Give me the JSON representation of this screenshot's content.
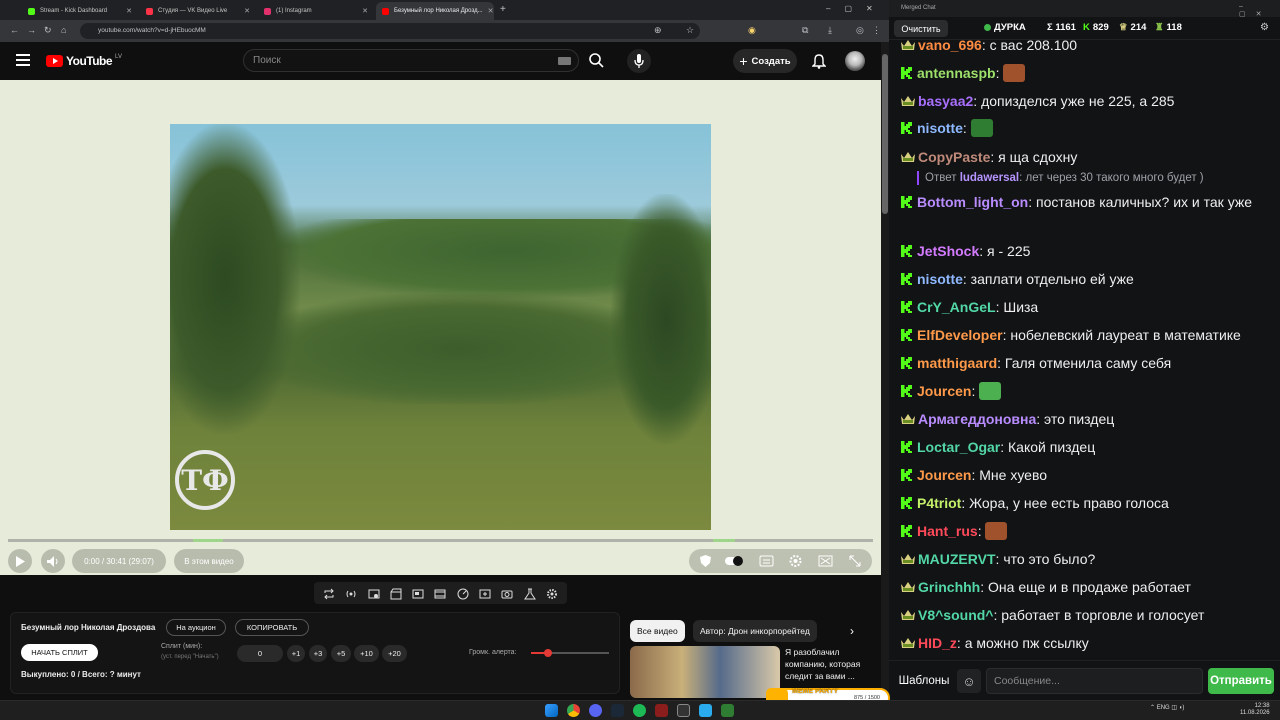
{
  "browser": {
    "tabs": [
      {
        "label": "Stream - Kick Dashboard",
        "color": "#53fc18"
      },
      {
        "label": "Студия — VK Видео Live",
        "color": "#ff3347"
      },
      {
        "label": "(1) Instagram",
        "color": "#e1306c"
      },
      {
        "label": "Безумный лор Николая Дрозд...",
        "color": "#ff0000"
      }
    ],
    "new_tab": "+",
    "url": "youtube.com/watch?v=d-jHEbuocMM"
  },
  "youtube": {
    "logo_text": "YouTube",
    "country": "LV",
    "search_placeholder": "Поиск",
    "create_label": "Создать"
  },
  "player": {
    "time": "0:00 / 30:41 (29:07)",
    "chapter_label": "В этом видео",
    "watermark": "ТФ"
  },
  "split_panel": {
    "title": "Безумный лор Николая Дроздова",
    "auction_btn": "На аукцион",
    "copy_btn": "КОПИРОВАТЬ",
    "start_btn": "НАЧАТЬ СПЛИТ",
    "split_label": "Сплит (мин):",
    "split_hint": "(уст. перед \"Начать\")",
    "split_value": "0",
    "increments": [
      "+1",
      "+3",
      "+5",
      "+10",
      "+20"
    ],
    "volume_label": "Громк. алерта:",
    "volume_level": 0.22,
    "bought": "Выкуплено: 0 / Всего: ? минут"
  },
  "related": {
    "chip_all": "Все видео",
    "chip_author": "Автор: Дрон инкорпорейтед",
    "video_title": "Я разоблачил компанию, которая следит за вами ..."
  },
  "chat": {
    "window_title": "Merged Chat",
    "clear_btn": "Очистить",
    "streamer": "ДУРКА",
    "total": "Σ 1161",
    "kick_count": "829",
    "vk_count": "214",
    "other_count": "118",
    "messages": [
      {
        "platform": "vk",
        "user": "vano_696",
        "color": "#ff8c42",
        "text": "с вас 208.100"
      },
      {
        "platform": "kick",
        "user": "antennaspb",
        "color": "#9de06a",
        "text": ""
      },
      {
        "platform": "vk",
        "user": "basyaa2",
        "color": "#a970ff",
        "text": "допизделся уже не 225, а 285"
      },
      {
        "platform": "kick",
        "user": "nisotte",
        "color": "#8fb9ff",
        "text": ""
      },
      {
        "platform": "vk",
        "user": "CopyPaste",
        "color": "#c08a7a",
        "text": "я ща сдохну"
      },
      {
        "platform": "reply",
        "prefix": "Ответ",
        "user": "ludawersal",
        "color": "#b694ff",
        "text": "лет через 30 такого много будет )"
      },
      {
        "platform": "kick",
        "user": "Bottom_light_on",
        "color": "#b98cff",
        "text": "постанов каличных? их и так уже"
      },
      {
        "platform": "kick",
        "user": "JetShock",
        "color": "#d47bff",
        "text": "я - 225"
      },
      {
        "platform": "kick",
        "user": "nisotte",
        "color": "#8fb9ff",
        "text": "заплати отдельно ей уже"
      },
      {
        "platform": "kick",
        "user": "CrY_AnGeL",
        "color": "#53d7a6",
        "text": "Шиза"
      },
      {
        "platform": "kick",
        "user": "ElfDeveloper",
        "color": "#ff9a4a",
        "text": "нобелевский лауреат в математике"
      },
      {
        "platform": "kick",
        "user": "matthigaard",
        "color": "#ff9a4a",
        "text": "Галя отменила саму себя"
      },
      {
        "platform": "kick",
        "user": "Jourcen",
        "color": "#ff9a4a",
        "text": ""
      },
      {
        "platform": "vk",
        "user": "Армагеддоновна",
        "color": "#b98cff",
        "text": "это пиздец"
      },
      {
        "platform": "kick",
        "user": "Loctar_Ogar",
        "color": "#53d7a6",
        "text": "Какой пиздец"
      },
      {
        "platform": "kick",
        "user": "Jourcen",
        "color": "#ff9a4a",
        "text": "Мне хуево"
      },
      {
        "platform": "kick",
        "user": "P4triot",
        "color": "#c4f06a",
        "text": "Жора, у нее есть право голоса"
      },
      {
        "platform": "kick",
        "user": "Hant_rus",
        "color": "#ff4a5a",
        "text": ""
      },
      {
        "platform": "vk",
        "user": "MAUZERVT",
        "color": "#53d7a6",
        "text": "что это было?"
      },
      {
        "platform": "vk",
        "user": "Grinchhh",
        "color": "#53d7a6",
        "text": "Она еще и в продаже работает"
      },
      {
        "platform": "vk",
        "user": "V8^sound^",
        "color": "#53d7a6",
        "text": "работает в торговле и голосует"
      },
      {
        "platform": "vk",
        "user": "HID_z",
        "color": "#ff4a5a",
        "text": "а можно пж ссылку"
      }
    ],
    "templates_btn": "Шаблоны",
    "input_placeholder": "Сообщение...",
    "send_btn": "Отправить"
  },
  "overlay": {
    "title": "МЕМЕ PARTY",
    "count": "875 / 1500"
  },
  "taskbar": {
    "lang": "ENG",
    "time": "12:38",
    "date": "11.08.2026"
  }
}
